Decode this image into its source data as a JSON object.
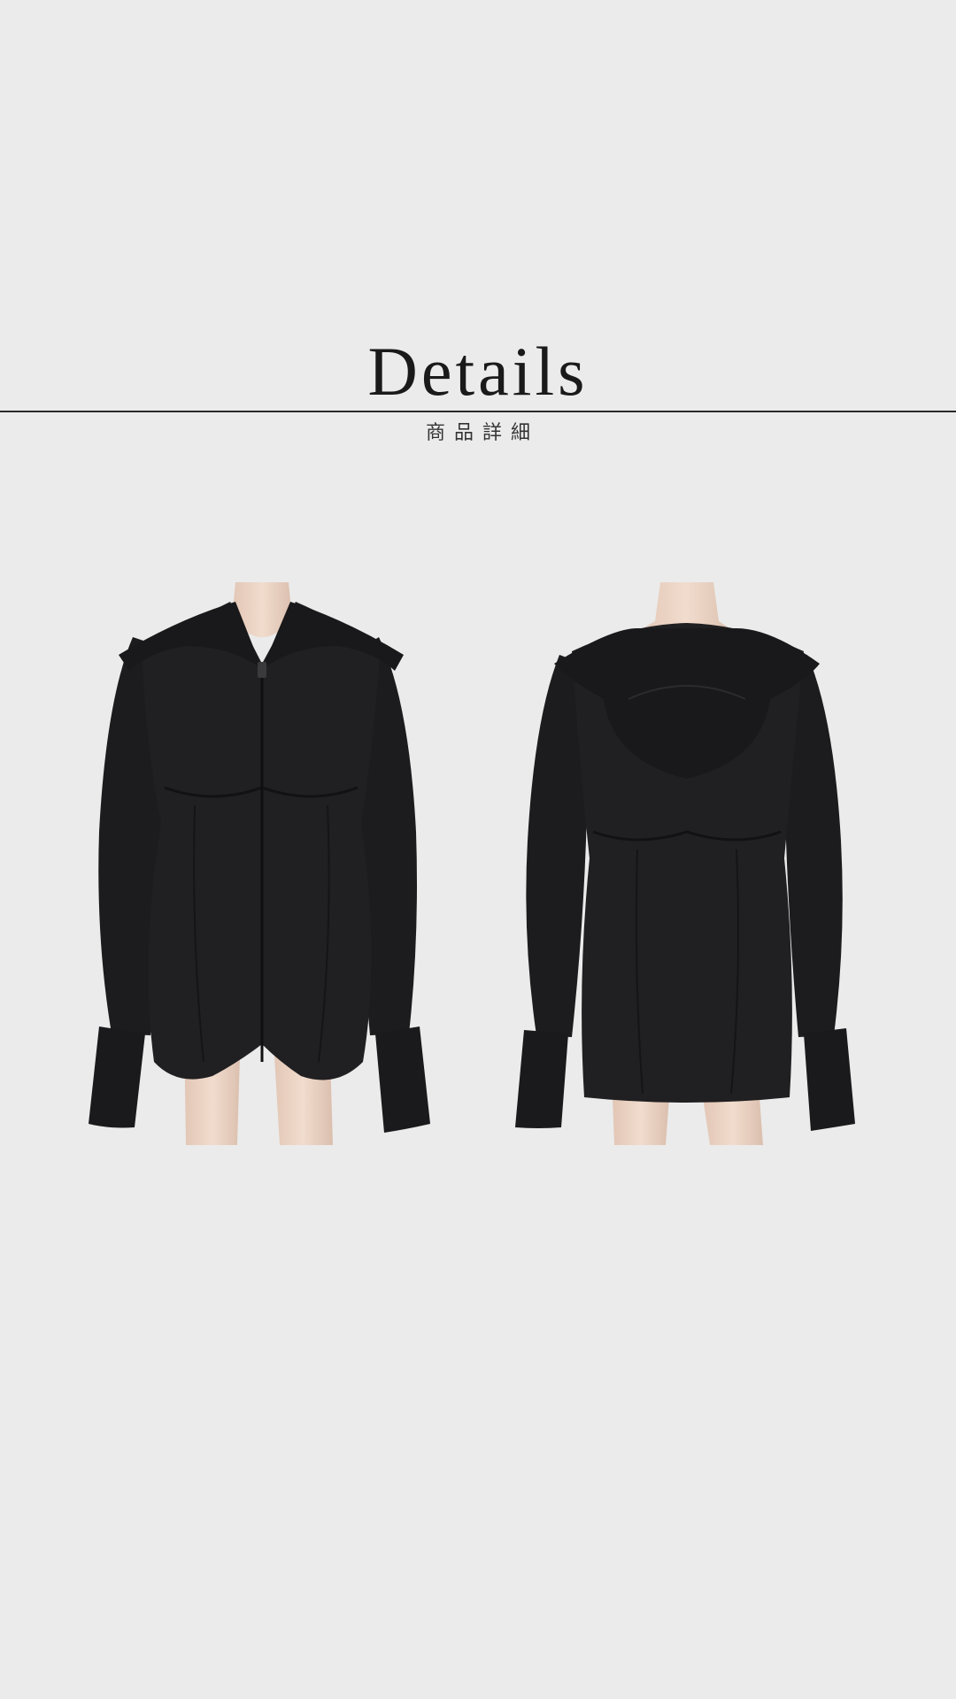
{
  "heading": {
    "title": "Details",
    "subtitle": "商品詳細"
  },
  "photos": [
    {
      "view": "front",
      "description_icon": "garment-front-image"
    },
    {
      "view": "back",
      "description_icon": "garment-back-image"
    }
  ],
  "colors": {
    "background": "#ebebeb",
    "garment": "#1e1d1f",
    "mannequin": "#ead2c2",
    "rule": "#2a2a2a"
  }
}
